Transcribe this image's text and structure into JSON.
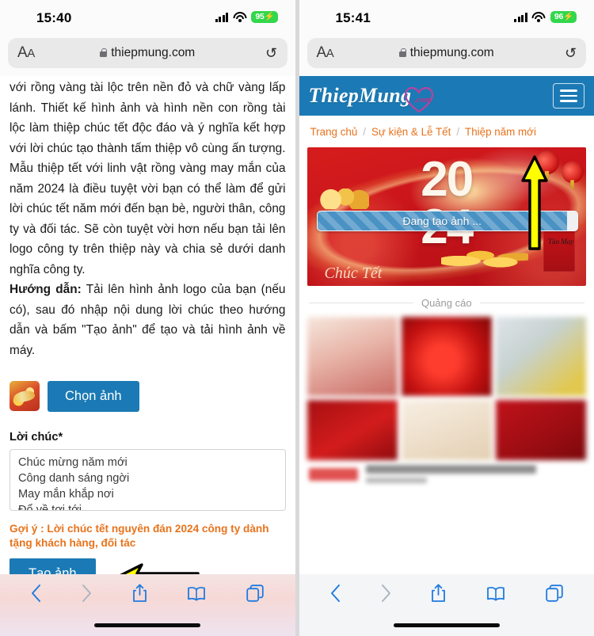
{
  "left": {
    "status": {
      "time": "15:40",
      "battery": "95",
      "battery_icon": "battery-charging-icon",
      "wifi_icon": "wifi-icon",
      "signal_icon": "cellular-bars-icon"
    },
    "urlbar": {
      "aa_label": "AA",
      "lock_icon": "lock-icon",
      "domain": "thiepmung.com",
      "reload_icon": "reload-icon"
    },
    "article": {
      "p1": "với rồng vàng tài lộc trên nền đỏ và chữ vàng lấp lánh. Thiết kế hình ảnh và hình nền con rồng tài lộc làm thiệp chúc tết độc đáo và ý nghĩa kết hợp với lời chúc tạo thành tấm thiệp vô cùng ấn tượng. Mẫu thiệp tết với linh vật rồng vàng may mắn của năm 2024 là điều tuyệt vời bạn có thể làm để gửi lời chúc tết năm mới đến bạn bè, người thân, công ty và đối tác. Sẽ còn tuyệt vời hơn nếu bạn tải lên logo công ty trên thiệp này và chia sẻ dưới danh nghĩa công ty.",
      "p2_label": "Hướng dẫn:",
      "p2_text": " Tải lên hình ảnh logo của bạn (nếu có), sau đó nhập nội dung lời chúc theo hướng dẫn và bấm \"Tạo ảnh\" để tạo và tải hình ảnh về máy."
    },
    "form": {
      "thumbnail_icon": "image-thumbnail",
      "choose_image_button": "Chọn ảnh",
      "wish_label": "Lời chúc*",
      "wish_lines": [
        "Chúc mừng năm mới",
        "Công danh sáng ngời",
        "May mắn khắp nơi",
        "Đổ về tơi tới"
      ],
      "hint": "Gợi ý : Lời chúc tết nguyên đán 2024 công ty dành tặng khách hàng, đối tác",
      "create_button": "Tạo ảnh",
      "arrow_icon": "yellow-left-arrow-annotation"
    },
    "toolbar": {
      "back_icon": "back-chevron-icon",
      "forward_icon": "forward-chevron-icon",
      "share_icon": "share-icon",
      "bookmarks_icon": "bookmarks-book-icon",
      "tabs_icon": "tabs-icon"
    }
  },
  "right": {
    "status": {
      "time": "15:41",
      "battery": "96",
      "battery_icon": "battery-charging-icon",
      "wifi_icon": "wifi-icon",
      "signal_icon": "cellular-bars-icon"
    },
    "urlbar": {
      "aa_label": "AA",
      "lock_icon": "lock-icon",
      "domain": "thiepmung.com",
      "reload_icon": "reload-icon"
    },
    "site": {
      "logo_text": "ThiepMung",
      "logo_suffix": ".com",
      "logo_heart_icon": "heart-icon",
      "menu_icon": "hamburger-menu-icon",
      "breadcrumb": [
        "Trang chủ",
        "Sự kiện & Lễ Tết",
        "Thiệp năm mới"
      ],
      "breadcrumb_separator": "/"
    },
    "card": {
      "year_top": "20",
      "year_bottom": "24",
      "envelope_text": "Tào\nMay",
      "script_text": "Chúc Tết",
      "lantern_icon": "lantern-icon",
      "dragon_icon": "golden-dragon-icon"
    },
    "progress": {
      "label": "Đang tạo ảnh ...",
      "percent": 96
    },
    "ads": {
      "label": "Quảng cáo",
      "arrow_icon": "yellow-up-arrow-annotation"
    },
    "toolbar": {
      "back_icon": "back-chevron-icon",
      "forward_icon": "forward-chevron-icon",
      "share_icon": "share-icon",
      "bookmarks_icon": "bookmarks-book-icon",
      "tabs_icon": "tabs-icon"
    }
  },
  "colors": {
    "brand_blue": "#1b7ab5",
    "hint_orange": "#e8731c",
    "card_red": "#c8141a",
    "battery_green": "#32d74b",
    "annotation_yellow": "#ffff00"
  }
}
